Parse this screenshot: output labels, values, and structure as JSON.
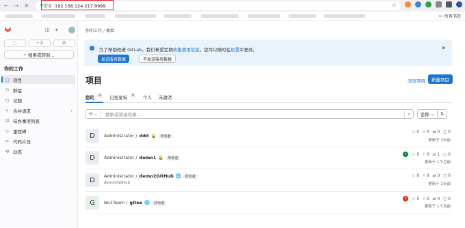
{
  "browser": {
    "insecure_label": "不安全",
    "url": "192.168.124.217:9999",
    "all_bookmarks": "所有书签"
  },
  "sidebar": {
    "create_button": "+",
    "mr_count": "2",
    "search_label": "搜索或转到...",
    "section_title": "你的工作",
    "items": [
      {
        "label": "项目",
        "icon": "project-icon",
        "active": true
      },
      {
        "label": "群组",
        "icon": "group-icon"
      },
      {
        "label": "议题",
        "icon": "issues-icon"
      },
      {
        "label": "合并请求",
        "icon": "merge-request-icon"
      },
      {
        "label": "待办事项列表",
        "icon": "todo-icon"
      },
      {
        "label": "里程碑",
        "icon": "milestone-icon"
      },
      {
        "label": "代码片段",
        "icon": "snippet-icon"
      },
      {
        "label": "动态",
        "icon": "activity-icon"
      }
    ]
  },
  "breadcrumb": {
    "parent": "你的工作",
    "current": "项目"
  },
  "banner": {
    "text_before": "为了帮助改进 GitLab，我们希望定期",
    "link1": "收集使用信息",
    "text_middle": "。您可以随时在",
    "link2": "设置",
    "text_after": "中更改。",
    "primary_button": "发送服务数据",
    "secondary_button": "不发送服务数据"
  },
  "page": {
    "title": "项目",
    "explore_link": "浏览项目",
    "new_button": "新建项目"
  },
  "tabs": [
    {
      "label": "您的",
      "count": "4",
      "active": true
    },
    {
      "label": "已加星标",
      "count": "0"
    },
    {
      "label": "个人",
      "count": ""
    },
    {
      "label": "未激活",
      "count": ""
    }
  ],
  "filter": {
    "placeholder": "搜索或筛选结果...",
    "sort_label": "名称"
  },
  "projects": [
    {
      "avatar": "D",
      "avatar_color": "#e7ebf2",
      "namespace": "Administrator / ",
      "name": "ddd",
      "visibility_icon": "lock-icon",
      "visibility": "🔒",
      "role": "所有者",
      "description": "",
      "stars": "0",
      "forks": "0",
      "mrs": "0",
      "issues": "0",
      "updated": "更新于 3天前",
      "status": ""
    },
    {
      "avatar": "D",
      "avatar_color": "#e7ebf2",
      "namespace": "Administrator / ",
      "name": "demo1",
      "visibility_icon": "lock-icon",
      "visibility": "🔒",
      "role": "所有者",
      "description": "",
      "stars": "0",
      "forks": "0",
      "mrs": "1",
      "issues": "0",
      "updated": "更新于 1个月前",
      "status": "ok"
    },
    {
      "avatar": "D",
      "avatar_color": "#e7ebf2",
      "namespace": "Administrator / ",
      "name": "demo2GitHub",
      "visibility_icon": "globe-icon",
      "visibility": "🌐",
      "role": "所有者",
      "description": "demo2GitHub",
      "stars": "0",
      "forks": "0",
      "mrs": "0",
      "issues": "0",
      "updated": "更新于 2天前",
      "status": ""
    },
    {
      "avatar": "G",
      "avatar_color": "#e3f1e7",
      "namespace": "No1Team / ",
      "name": "gitee",
      "visibility_icon": "globe-icon",
      "visibility": "🌐",
      "role": "所有者",
      "description": "",
      "stars": "0",
      "forks": "0",
      "mrs": "0",
      "issues": "0",
      "updated": "更新于 1个月前",
      "status": "fail"
    }
  ]
}
